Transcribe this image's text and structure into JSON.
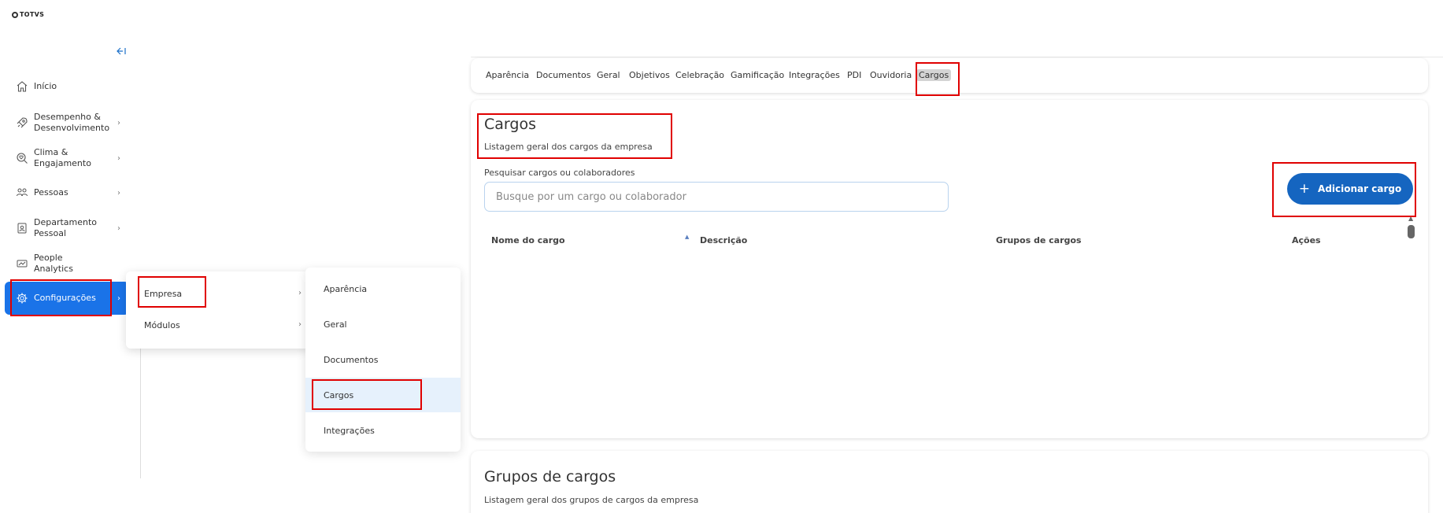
{
  "brand": {
    "name": "TOTVS"
  },
  "sidebar": {
    "collapse_icon": "collapse-left-icon",
    "items": [
      {
        "label": "Início",
        "icon": "home-icon",
        "has_children": false
      },
      {
        "label": "Desempenho & Desenvolvimento",
        "icon": "rocket-icon",
        "has_children": true
      },
      {
        "label": "Clima & Engajamento",
        "icon": "search-heart-icon",
        "has_children": true
      },
      {
        "label": "Pessoas",
        "icon": "people-icon",
        "has_children": true
      },
      {
        "label": "Departamento Pessoal",
        "icon": "badge-icon",
        "has_children": true
      },
      {
        "label": "People Analytics",
        "icon": "analytics-icon",
        "has_children": false
      },
      {
        "label": "Configurações",
        "icon": "gear-icon",
        "has_children": true,
        "active": true
      }
    ]
  },
  "submenu_config": {
    "items": [
      {
        "label": "Empresa",
        "has_children": true
      },
      {
        "label": "Módulos",
        "has_children": true
      }
    ]
  },
  "submenu_empresa": {
    "items": [
      {
        "label": "Aparência"
      },
      {
        "label": "Geral"
      },
      {
        "label": "Documentos"
      },
      {
        "label": "Cargos",
        "selected": true
      },
      {
        "label": "Integrações"
      }
    ]
  },
  "tabs": [
    {
      "label": "Aparência"
    },
    {
      "label": "Documentos"
    },
    {
      "label": "Geral"
    },
    {
      "label": "Objetivos"
    },
    {
      "label": "Celebração"
    },
    {
      "label": "Gamificação"
    },
    {
      "label": "Integrações"
    },
    {
      "label": "PDI"
    },
    {
      "label": "Ouvidoria"
    },
    {
      "label": "Cargos",
      "selected": true
    }
  ],
  "cargos": {
    "title": "Cargos",
    "subtitle": "Listagem geral dos cargos da empresa",
    "search_label": "Pesquisar cargos ou colaboradores",
    "search_placeholder": "Busque por um cargo ou colaborador",
    "add_button": "Adicionar cargo",
    "columns": [
      "Nome do cargo",
      "Descrição",
      "Grupos de cargos",
      "Ações"
    ],
    "rows": []
  },
  "grupos": {
    "title": "Grupos de cargos",
    "subtitle": "Listagem geral dos grupos de cargos da empresa"
  },
  "colors": {
    "accent": "#1a73e8",
    "button": "#1565c0",
    "highlight": "#e00000",
    "selected_menu_bg": "#e6f1fc"
  }
}
